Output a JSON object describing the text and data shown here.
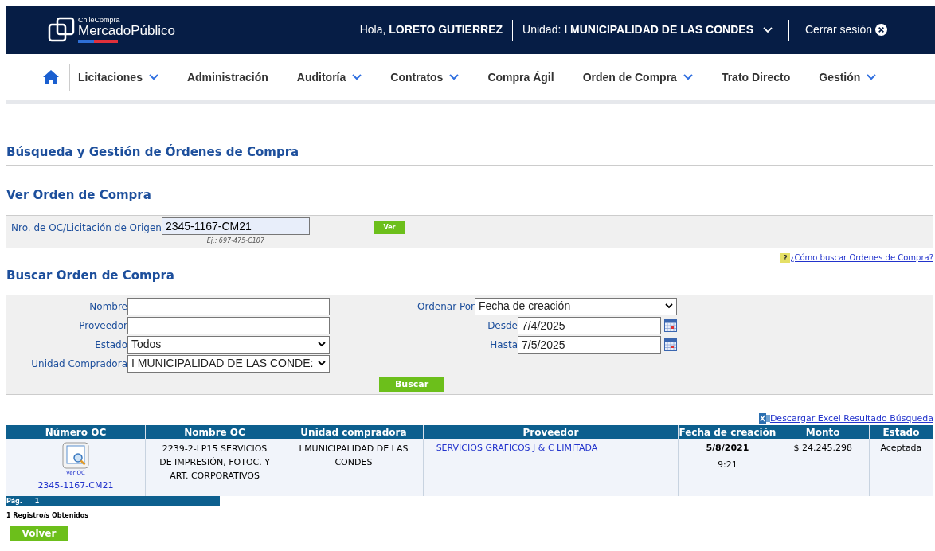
{
  "header": {
    "logo_small": "ChileCompra",
    "logo_big": "MercadoPúblico",
    "greeting": "Hola,",
    "user": "LORETO GUTIERREZ",
    "unit_label": "Unidad:",
    "unit": "I MUNICIPALIDAD DE LAS CONDES",
    "logout": "Cerrar sesión"
  },
  "nav": [
    {
      "label": "Licitaciones",
      "has_menu": true
    },
    {
      "label": "Administración",
      "has_menu": false
    },
    {
      "label": "Auditoría",
      "has_menu": true
    },
    {
      "label": "Contratos",
      "has_menu": true
    },
    {
      "label": "Compra Ágil",
      "has_menu": false
    },
    {
      "label": "Orden de Compra",
      "has_menu": true
    },
    {
      "label": "Trato Directo",
      "has_menu": false
    },
    {
      "label": "Gestión",
      "has_menu": true
    }
  ],
  "page_title": "Búsqueda y Gestión de Órdenes de Compra",
  "view": {
    "title": "Ver Orden de Compra",
    "label": "Nro. de OC/Licitación de Origen",
    "value": "2345-1167-CM21",
    "example": "Ej.: 697-475-C107",
    "button": "Ver"
  },
  "help_icon": "?",
  "help_link": "¿Cómo buscar Ordenes de Compra?",
  "search": {
    "title": "Buscar Orden de Compra",
    "left": [
      {
        "label": "Nombre",
        "kind": "text"
      },
      {
        "label": "Proveedor",
        "kind": "text"
      },
      {
        "label": "Estado",
        "kind": "select",
        "value": "Todos"
      },
      {
        "label": "Unidad Compradora",
        "kind": "select",
        "value": "I MUNICIPALIDAD DE LAS CONDE:"
      }
    ],
    "right": [
      {
        "label": "Ordenar Por",
        "kind": "select",
        "value": "Fecha de creación"
      },
      {
        "label": "Desde",
        "kind": "date",
        "value": "7/4/2025"
      },
      {
        "label": "Hasta",
        "kind": "date",
        "value": "7/5/2025"
      }
    ],
    "button": "Buscar"
  },
  "excel_link": "Descargar Excel Resultado Búsqueda",
  "table": {
    "columns": [
      "Número OC",
      "Nombre OC",
      "Unidad compradora",
      "Proveedor",
      "Fecha de creación",
      "Monto",
      "Estado"
    ],
    "rows": [
      {
        "view_label": "Ver OC",
        "number": "2345-1167-CM21",
        "name": "2239-2-LP15 SERVICIOS DE IMPRESIÓN, FOTOC. Y ART. CORPORATIVOS",
        "unit": "I MUNICIPALIDAD DE LAS CONDES",
        "supplier": "SERVICIOS GRAFICOS J & C LIMITADA",
        "date": "5/8/2021",
        "time": "9:21",
        "amount": "$ 24.245.298",
        "status": "Aceptada"
      }
    ]
  },
  "pager": {
    "label": "Pág.",
    "page": "1"
  },
  "records": "1 Registro/s Obtenidos",
  "back_button": "Volver"
}
